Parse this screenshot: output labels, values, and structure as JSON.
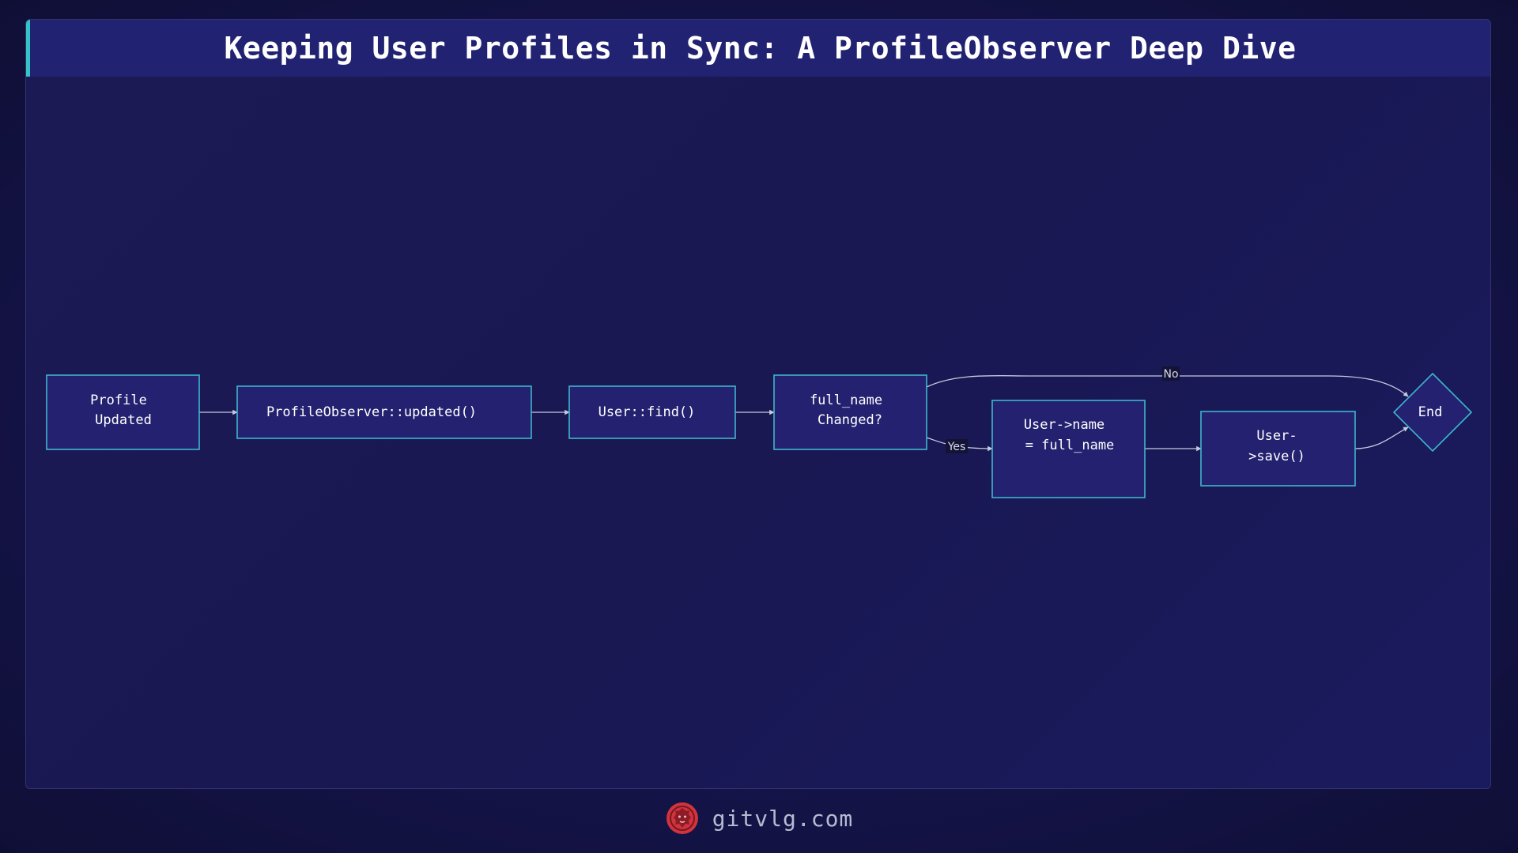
{
  "title": "Keeping User Profiles in Sync: A ProfileObserver Deep Dive",
  "nodes": {
    "profile_updated": [
      "Profile",
      "Updated"
    ],
    "observer_updated": [
      "ProfileObserver::updated()"
    ],
    "user_find": [
      "User::find()"
    ],
    "name_changed": [
      "full_name",
      "Changed?"
    ],
    "assign_name": [
      "User->name",
      "= full_name"
    ],
    "user_save": [
      "User-",
      ">save()"
    ],
    "end": [
      "End"
    ]
  },
  "edges": {
    "yes_label": "Yes",
    "no_label": "No"
  },
  "footer": {
    "site": "gitvlg.com",
    "logo_icon": "lion-head-icon"
  },
  "colors": {
    "background": "#15144a",
    "node_fill": "#232170",
    "node_stroke": "#3fb6cc",
    "title_bar": "#222272",
    "accent": "#35c3c8",
    "logo": "#d0343d"
  }
}
